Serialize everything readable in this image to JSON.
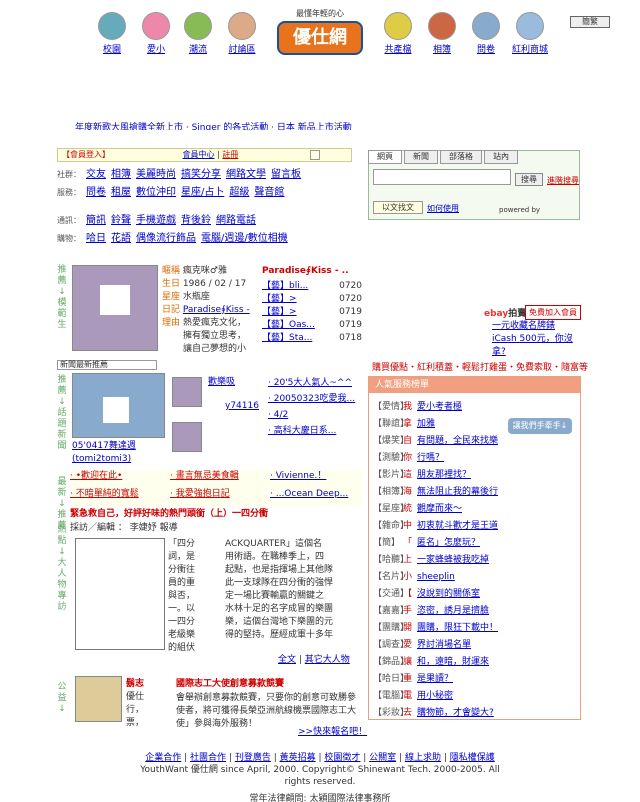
{
  "nav": {
    "items": [
      {
        "label": "校園",
        "icon": "school-icon",
        "color": "#6ab"
      },
      {
        "label": "愛小",
        "icon": "heart-icon",
        "color": "#e8a"
      },
      {
        "label": "潮流",
        "icon": "books-icon",
        "color": "#8b5"
      },
      {
        "label": "討論區",
        "icon": "chat-icon",
        "color": "#da8"
      },
      {
        "label": "共產檔",
        "icon": "star-icon",
        "color": "#dc4"
      },
      {
        "label": "相簿",
        "icon": "camera-icon",
        "color": "#c64"
      },
      {
        "label": "問卷",
        "icon": "question-icon",
        "color": "#8ac"
      },
      {
        "label": "紅利商城",
        "icon": "mall-icon",
        "color": "#9bd"
      }
    ],
    "logo_tag": "最懂年輕的心",
    "logo_text": "優仕網",
    "lang_button": "簡繁"
  },
  "ticker": "年度新歌大風搶購全新上市  ·  Singer 的各式活動  ·  日本 新品上市活動",
  "member": {
    "header": "【會員登入】",
    "center": "會員中心",
    "register": "註冊",
    "row1": {
      "k": "社群：",
      "links": [
        "交友",
        "相簿",
        "美麗時尚",
        "搞笑分享",
        "網路文學",
        "留言板"
      ]
    },
    "row2": {
      "k": "服務：",
      "links": [
        "問卷",
        "租屋",
        "數位沖印",
        "星座/占卜",
        "超級",
        "聲音館"
      ]
    },
    "row3": {
      "k": "通訊：",
      "links": [
        "簡訊",
        "鈴聲",
        "手機遊戲",
        "背後鈴",
        "網路電話"
      ]
    },
    "row4": {
      "k": "購物：",
      "links": [
        "哈日",
        "花語",
        "偶像流行飾品",
        "電腦/週邊/數位相機"
      ]
    }
  },
  "search": {
    "tabs": [
      "網頁",
      "新聞",
      "部落格",
      "站內"
    ],
    "button": "搜尋",
    "adv": "進階搜尋",
    "hint": "以文找文",
    "hint2": "如何使用",
    "powered": "powered by"
  },
  "rec": {
    "side": "推薦↓模範生",
    "name_k": "暱稱",
    "name": "瘋克咪♂雅",
    "birth_k": "生日",
    "birth": "1986 / 02 / 17",
    "star_k": "星座",
    "star": "水瓶座",
    "blog_k": "日記",
    "blog": "Paradise∮Kiss -",
    "reason_k": "理由",
    "reason": "熱愛瘋克文化，擁有獨立思考，讓自己夢想的小孩不...",
    "blog_title": "Paradise∮Kiss - ..",
    "posts": [
      {
        "t": "【藝】bli...",
        "d": "0720"
      },
      {
        "t": "【藝】>",
        "d": "0720"
      },
      {
        "t": "【藝】>",
        "d": "0719"
      },
      {
        "t": "【藝】Oas...",
        "d": "0719"
      },
      {
        "t": "【藝】Sta...",
        "d": "0718"
      }
    ]
  },
  "ebay": {
    "brand": "ebay",
    "label": "拍賣",
    "free": "免費加入會員",
    "l1": "一元收藏名牌錶",
    "l2": "iCash 500元，你沒",
    "l3": "拿?"
  },
  "news": {
    "side": "推薦↓話題新聞",
    "header": "新聞最新推薦",
    "caption": "05'0417舞達週(tomi2tomi3)",
    "items": [
      "20'5大人氣人~^^",
      "20050323吃愛我...",
      "4/2",
      "高科大慶日系..."
    ],
    "mid1": "歡樂吸",
    "mid2": "y74116"
  },
  "promo": {
    "side": "最新↓推薦",
    "links": [
      "•歡迎在此•",
      "畫言無忌美食輯",
      "Vivienne.！",
      "不暗單純的寬鬆",
      "我愛強抱日記",
      "...Ocean Deep..."
    ]
  },
  "links_bar": "購買優點・紅利積蓋・輕鬆打雞蛋・免費索取・隨富等",
  "hot": {
    "title": "人氣服務榜單",
    "ad": "讓我們手牽手↓",
    "rows": [
      [
        "【愛情】",
        "我",
        "愛小考者極"
      ],
      [
        "【聯誼】",
        "拿",
        "加雅"
      ],
      [
        "【爆笑】",
        "自",
        "有問題，全民來找樂"
      ],
      [
        "【測驗】",
        "你",
        "行嗎？"
      ],
      [
        "【影片】",
        "這",
        "朋友那裡找？"
      ],
      [
        "【相簿】",
        "海",
        "無法阻止我的幕後行"
      ],
      [
        "【星座】",
        "統",
        "觀摩而來～"
      ],
      [
        "【雜命】",
        "中",
        "初衷就斗歡才是王道"
      ],
      [
        "【簡】",
        "「",
        "匿名」怎麼玩？"
      ],
      [
        "【哈聽】",
        "上",
        "一家蜂蜂被我吃掉"
      ],
      [
        "【名片】",
        "小",
        "sheeplin"
      ],
      [
        "【交通】",
        "【",
        "沒說到的關係室"
      ],
      [
        "【嘉嘉】",
        "手",
        "恣密，誘月是擠臉"
      ],
      [
        "【團購】",
        "開",
        "團購，限狂下載中！"
      ],
      [
        "【調查】",
        "愛",
        "界討消場名單"
      ],
      [
        "【錦品】",
        "讓",
        "和，遠暗，財運來"
      ],
      [
        "【哈日】",
        "重",
        "是果讀？"
      ],
      [
        "【電腦】",
        "電",
        "用小秘密"
      ],
      [
        "【彩妝】",
        "去",
        "購物節，才會變大?"
      ]
    ]
  },
  "article": {
    "side": "熱點↓大人物專訪",
    "title": "緊急救自己，好評好味的熱門頭銜（上）一四分衝",
    "byline": "採訪／編輯 ： 李婕妤 報導",
    "lines": [
      "「四分",
      "ACKQUARTER」這個名",
      "詞，是",
      "用術語。在職棒季上，四",
      "分衝往",
      "起點，也是指揮場上其他隊",
      "員的重",
      "此一支球隊在四分衝的強悍",
      "與否，",
      "定一場比賽輸贏的關鍵之",
      "一。以",
      "水林十足的名字成冒的樂團",
      "一四分",
      "樂，這個台灣地下樂團的元",
      "老級樂",
      "得的堅持。歷經成軍十多年",
      "的組伏"
    ],
    "full": "全文",
    "other": "其它大人物"
  },
  "ambassador": {
    "side": "公益↓",
    "name": "鬍志",
    "l1": "優仕",
    "l2": "行，",
    "l3": "票，",
    "title": "國際志工大使創意募款競賽",
    "desc": "會舉辦創意募款競賽，只要你的創意可致勝參使者，將可獲得長榮亞洲航線機票國際志工大使」參與海外服務！",
    "more": ">>快來報名吧！"
  },
  "footer": {
    "links": [
      "企業合作",
      "社團合作",
      "刊登廣告",
      "黃英招募",
      "校園徵才",
      "公關室",
      "線上求助",
      "隱私權保護"
    ],
    "copy": "YouthWant 優仕網 since April, 2000. Copyright© Shinewant Tech. 2000-2005. All rights reserved.",
    "legal": "常年法律顧問: 太穎國際法律事務所"
  }
}
